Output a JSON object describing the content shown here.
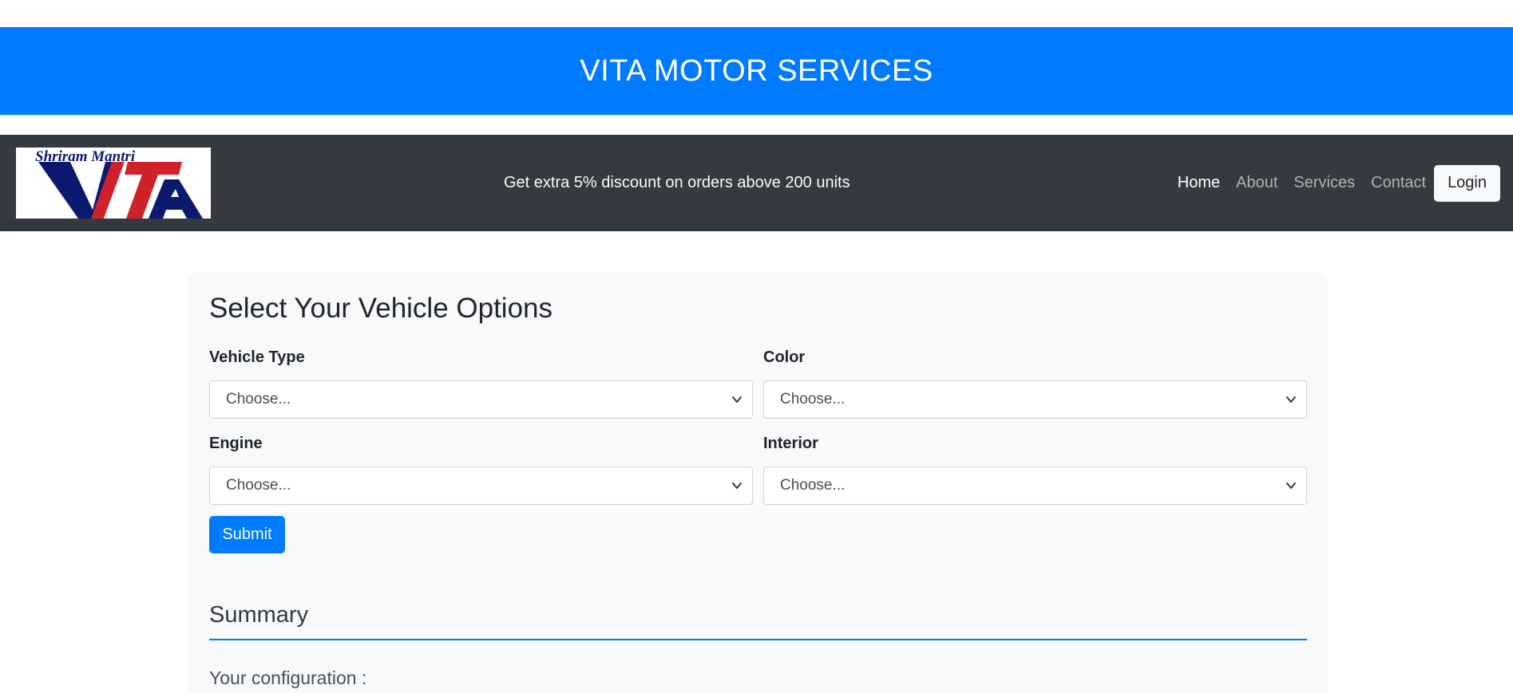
{
  "banner": {
    "title": "VITA MOTOR SERVICES",
    "color": "#007bff"
  },
  "navbar": {
    "logo": {
      "name": "Shriram Mantri VITA logo",
      "text_top": "Shriram Mantri",
      "text_main": "VITA"
    },
    "promo": "Get extra 5% discount on orders above 200 units",
    "links": [
      {
        "label": "Home",
        "active": true
      },
      {
        "label": "About",
        "active": false
      },
      {
        "label": "Services",
        "active": false
      },
      {
        "label": "Contact",
        "active": false
      }
    ],
    "login_label": "Login"
  },
  "form": {
    "title": "Select Your Vehicle Options",
    "fields": [
      {
        "label": "Vehicle Type",
        "value": "Choose..."
      },
      {
        "label": "Color",
        "value": "Choose..."
      },
      {
        "label": "Engine",
        "value": "Choose..."
      },
      {
        "label": "Interior",
        "value": "Choose..."
      }
    ],
    "submit_label": "Submit"
  },
  "summary": {
    "title": "Summary",
    "configuration_label": "Your configuration :"
  },
  "colors": {
    "primary": "#007bff",
    "navbar_bg": "#343a40",
    "card_bg": "#f8f9fa"
  }
}
